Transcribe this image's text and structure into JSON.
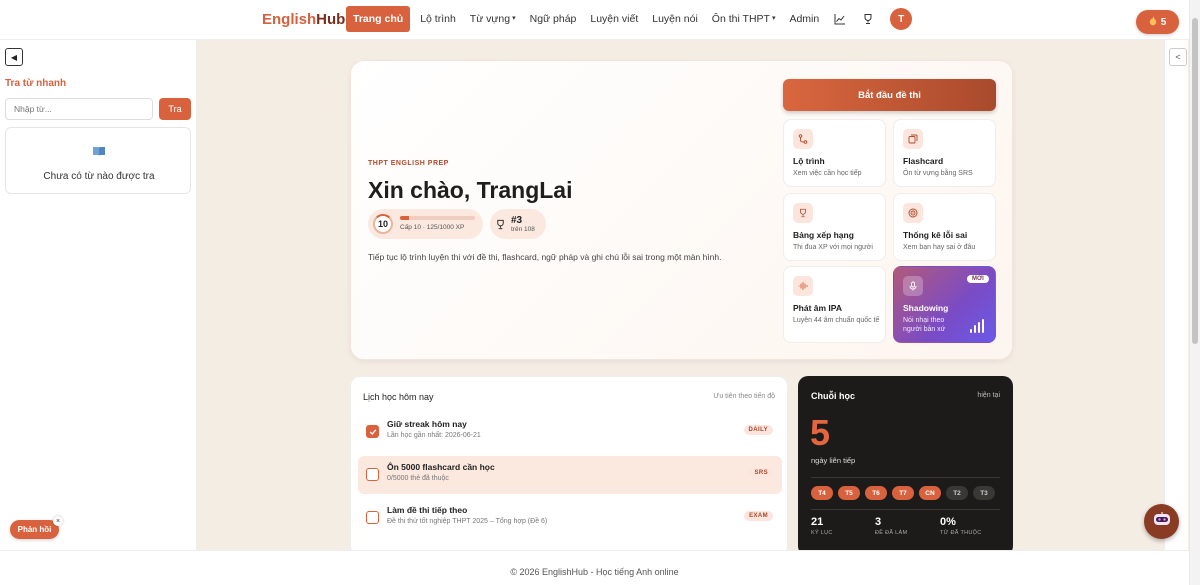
{
  "brand": {
    "part1": "English",
    "part2": "Hub"
  },
  "nav": {
    "items": [
      {
        "label": "Trang chủ",
        "active": true
      },
      {
        "label": "Lộ trình"
      },
      {
        "label": "Từ vựng",
        "dropdown": true
      },
      {
        "label": "Ngữ pháp"
      },
      {
        "label": "Luyện viết"
      },
      {
        "label": "Luyện nói"
      },
      {
        "label": "Ôn thi THPT",
        "dropdown": true
      },
      {
        "label": "Admin"
      }
    ],
    "avatar_initial": "T",
    "streak_count": "5"
  },
  "quick_lookup": {
    "title": "Tra từ nhanh",
    "placeholder": "Nhập từ...",
    "button": "Tra",
    "empty_text": "Chưa có từ nào được tra"
  },
  "hero": {
    "eyebrow": "THPT ENGLISH PREP",
    "greeting": "Xin chào, TrangLai",
    "level": "10",
    "level_text": "Cấp 10 · 125/1000 XP",
    "xp_progress": 0.125,
    "rank": "#3",
    "rank_sub": "trên 108",
    "description": "Tiếp tục lộ trình luyện thi với đề thi, flashcard, ngữ pháp và ghi chú lỗi sai trong một màn hình.",
    "start_button": "Bắt đầu đề thi",
    "tiles": [
      {
        "title": "Lộ trình",
        "sub": "Xem việc cần học tiếp",
        "icon": "route-icon"
      },
      {
        "title": "Flashcard",
        "sub": "Ôn từ vựng bằng SRS",
        "icon": "cards-icon"
      },
      {
        "title": "Bảng xếp hạng",
        "sub": "Thi đua XP với mọi người",
        "icon": "trophy-icon"
      },
      {
        "title": "Thống kê lỗi sai",
        "sub": "Xem bạn hay sai ở đâu",
        "icon": "target-icon"
      },
      {
        "title": "Phát âm IPA",
        "sub": "Luyện 44 âm chuẩn quốc tế",
        "icon": "waveform-icon"
      },
      {
        "title": "Shadowing",
        "sub": "Nói nhại theo người bản xứ",
        "icon": "microphone-icon",
        "badge": "MỚI"
      }
    ]
  },
  "schedule": {
    "title": "Lịch học hôm nay",
    "hint": "Ưu tiên theo tiến độ",
    "tasks": [
      {
        "title": "Giữ streak hôm nay",
        "sub": "Lần học gần nhất: 2026-06-21",
        "tag": "DAILY",
        "done": true
      },
      {
        "title": "Ôn 5000 flashcard cần học",
        "sub": "0/5000 thẻ đã thuộc",
        "tag": "SRS",
        "done": false
      },
      {
        "title": "Làm đề thi tiếp theo",
        "sub": "Đề thi thử tốt nghiệp THPT 2025 – Tổng hợp (Đề 6)",
        "tag": "EXAM",
        "done": false
      }
    ]
  },
  "streak": {
    "title": "Chuỗi học",
    "hint": "hiện tại",
    "count": "5",
    "sub": "ngày liên tiếp",
    "days": [
      {
        "label": "T4",
        "on": true
      },
      {
        "label": "T5",
        "on": true
      },
      {
        "label": "T6",
        "on": true
      },
      {
        "label": "T7",
        "on": true
      },
      {
        "label": "CN",
        "on": true
      },
      {
        "label": "T2",
        "on": false
      },
      {
        "label": "T3",
        "on": false
      }
    ],
    "stats": [
      {
        "value": "21",
        "label": "KỶ LỤC"
      },
      {
        "value": "3",
        "label": "ĐỀ ĐÃ LÀM"
      },
      {
        "value": "0%",
        "label": "TỪ ĐÃ THUỘC"
      }
    ]
  },
  "footer": "© 2026 EnglishHub - Học tiếng Anh online",
  "feedback": "Phản hồi",
  "colors": {
    "accent": "#d9623e",
    "dark_card": "#1c1b19"
  }
}
